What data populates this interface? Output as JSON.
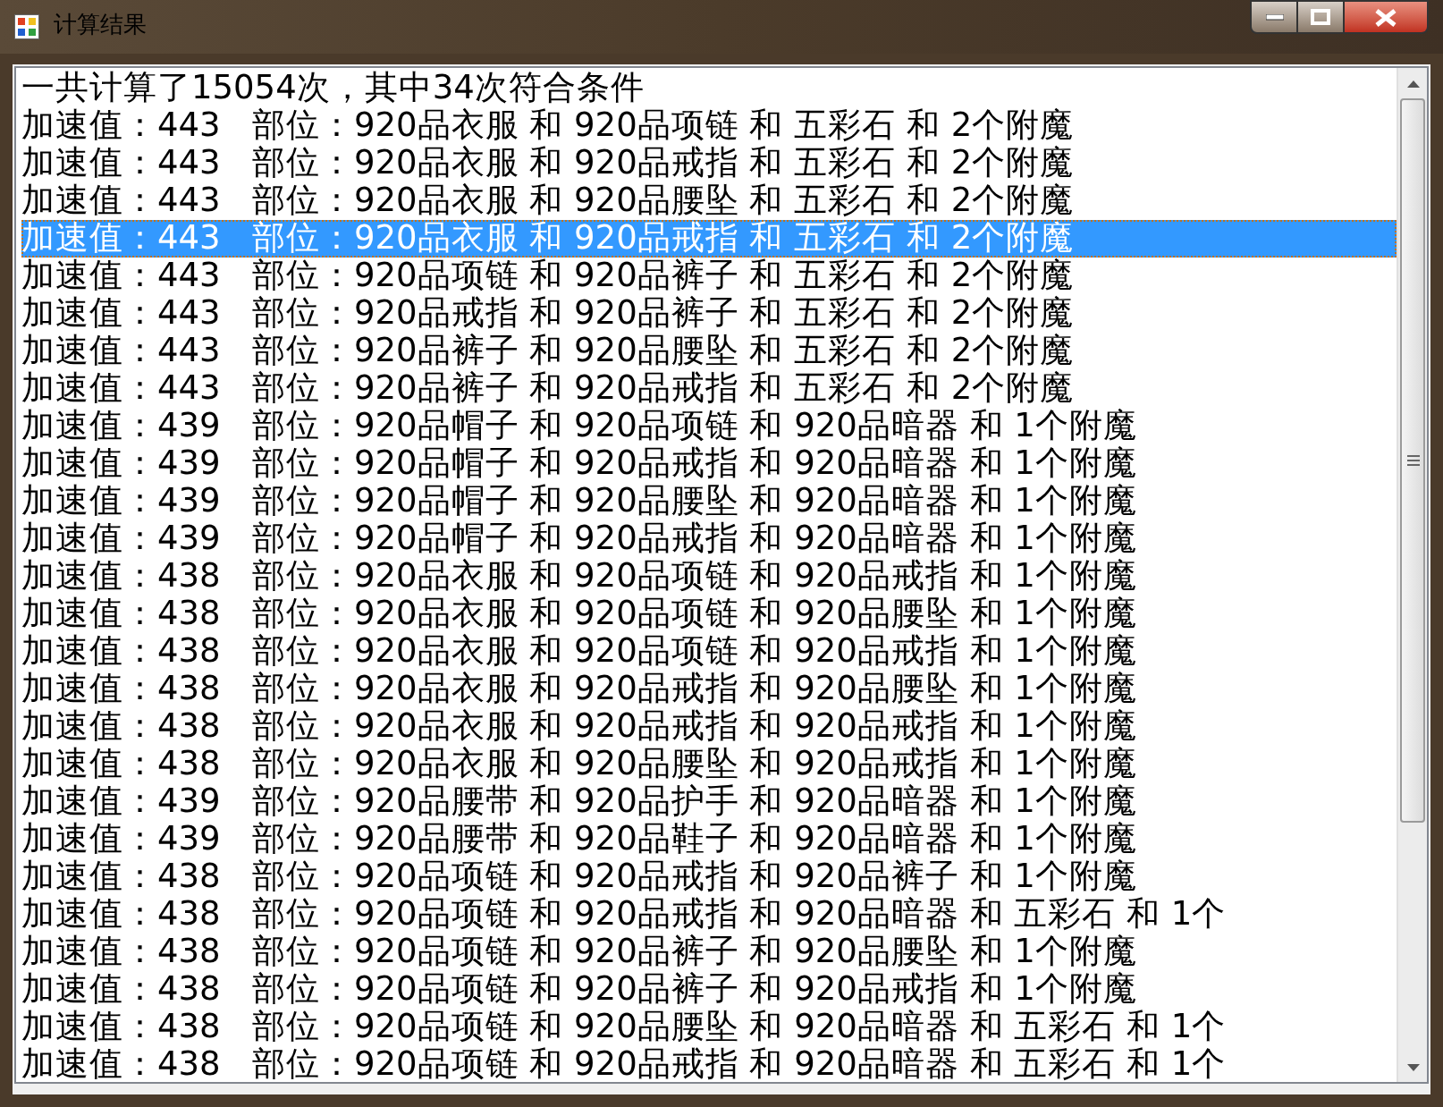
{
  "window": {
    "title": "计算结果"
  },
  "list": {
    "items": [
      {
        "text": "一共计算了15054次，其中34次符合条件",
        "selected": false
      },
      {
        "text": "加速值：443   部位：920品衣服 和 920品项链 和 五彩石 和 2个附魔",
        "selected": false
      },
      {
        "text": "加速值：443   部位：920品衣服 和 920品戒指 和 五彩石 和 2个附魔",
        "selected": false
      },
      {
        "text": "加速值：443   部位：920品衣服 和 920品腰坠 和 五彩石 和 2个附魔",
        "selected": false
      },
      {
        "text": "加速值：443   部位：920品衣服 和 920品戒指 和 五彩石 和 2个附魔",
        "selected": true
      },
      {
        "text": "加速值：443   部位：920品项链 和 920品裤子 和 五彩石 和 2个附魔",
        "selected": false
      },
      {
        "text": "加速值：443   部位：920品戒指 和 920品裤子 和 五彩石 和 2个附魔",
        "selected": false
      },
      {
        "text": "加速值：443   部位：920品裤子 和 920品腰坠 和 五彩石 和 2个附魔",
        "selected": false
      },
      {
        "text": "加速值：443   部位：920品裤子 和 920品戒指 和 五彩石 和 2个附魔",
        "selected": false
      },
      {
        "text": "加速值：439   部位：920品帽子 和 920品项链 和 920品暗器 和 1个附魔",
        "selected": false
      },
      {
        "text": "加速值：439   部位：920品帽子 和 920品戒指 和 920品暗器 和 1个附魔",
        "selected": false
      },
      {
        "text": "加速值：439   部位：920品帽子 和 920品腰坠 和 920品暗器 和 1个附魔",
        "selected": false
      },
      {
        "text": "加速值：439   部位：920品帽子 和 920品戒指 和 920品暗器 和 1个附魔",
        "selected": false
      },
      {
        "text": "加速值：438   部位：920品衣服 和 920品项链 和 920品戒指 和 1个附魔",
        "selected": false
      },
      {
        "text": "加速值：438   部位：920品衣服 和 920品项链 和 920品腰坠 和 1个附魔",
        "selected": false
      },
      {
        "text": "加速值：438   部位：920品衣服 和 920品项链 和 920品戒指 和 1个附魔",
        "selected": false
      },
      {
        "text": "加速值：438   部位：920品衣服 和 920品戒指 和 920品腰坠 和 1个附魔",
        "selected": false
      },
      {
        "text": "加速值：438   部位：920品衣服 和 920品戒指 和 920品戒指 和 1个附魔",
        "selected": false
      },
      {
        "text": "加速值：438   部位：920品衣服 和 920品腰坠 和 920品戒指 和 1个附魔",
        "selected": false
      },
      {
        "text": "加速值：439   部位：920品腰带 和 920品护手 和 920品暗器 和 1个附魔",
        "selected": false
      },
      {
        "text": "加速值：439   部位：920品腰带 和 920品鞋子 和 920品暗器 和 1个附魔",
        "selected": false
      },
      {
        "text": "加速值：438   部位：920品项链 和 920品戒指 和 920品裤子 和 1个附魔",
        "selected": false
      },
      {
        "text": "加速值：438   部位：920品项链 和 920品戒指 和 920品暗器 和 五彩石 和 1个",
        "selected": false
      },
      {
        "text": "加速值：438   部位：920品项链 和 920品裤子 和 920品腰坠 和 1个附魔",
        "selected": false
      },
      {
        "text": "加速值：438   部位：920品项链 和 920品裤子 和 920品戒指 和 1个附魔",
        "selected": false
      },
      {
        "text": "加速值：438   部位：920品项链 和 920品腰坠 和 920品暗器 和 五彩石 和 1个",
        "selected": false
      },
      {
        "text": "加速值：438   部位：920品项链 和 920品戒指 和 920品暗器 和 五彩石 和 1个",
        "selected": false
      }
    ]
  }
}
